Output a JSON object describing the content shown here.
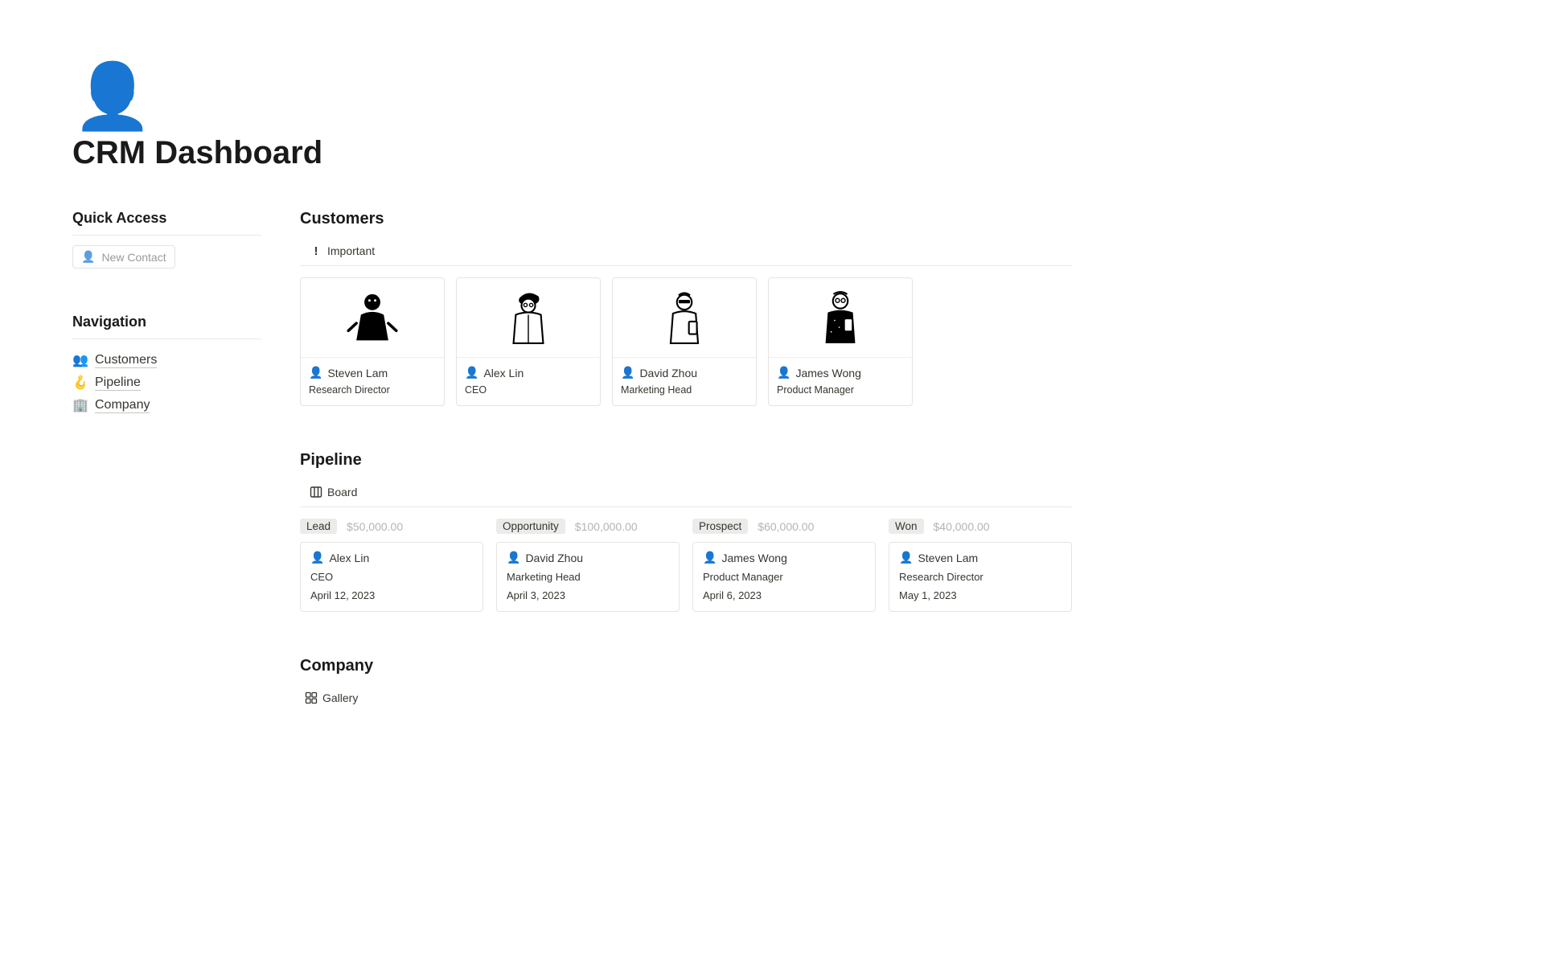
{
  "page": {
    "icon": "👤",
    "title": "CRM Dashboard"
  },
  "sidebar": {
    "quickAccessHeading": "Quick Access",
    "newContactLabel": "New Contact",
    "navigationHeading": "Navigation",
    "navItems": [
      {
        "emoji": "👥",
        "label": "Customers"
      },
      {
        "emoji": "🪝",
        "label": "Pipeline"
      },
      {
        "emoji": "🏢",
        "label": "Company"
      }
    ]
  },
  "customers": {
    "heading": "Customers",
    "viewLabel": "Important",
    "cards": [
      {
        "name": "Steven Lam",
        "role": "Research Director"
      },
      {
        "name": "Alex Lin",
        "role": "CEO"
      },
      {
        "name": "David Zhou",
        "role": "Marketing Head"
      },
      {
        "name": "James Wong",
        "role": "Product Manager"
      }
    ]
  },
  "pipeline": {
    "heading": "Pipeline",
    "viewLabel": "Board",
    "columns": [
      {
        "tag": "Lead",
        "amount": "$50,000.00",
        "card": {
          "name": "Alex Lin",
          "role": "CEO",
          "date": "April 12, 2023"
        }
      },
      {
        "tag": "Opportunity",
        "amount": "$100,000.00",
        "card": {
          "name": "David Zhou",
          "role": "Marketing Head",
          "date": "April 3, 2023"
        }
      },
      {
        "tag": "Prospect",
        "amount": "$60,000.00",
        "card": {
          "name": "James Wong",
          "role": "Product Manager",
          "date": "April 6, 2023"
        }
      },
      {
        "tag": "Won",
        "amount": "$40,000.00",
        "card": {
          "name": "Steven Lam",
          "role": "Research Director",
          "date": "May 1, 2023"
        }
      }
    ]
  },
  "company": {
    "heading": "Company",
    "viewLabel": "Gallery"
  }
}
